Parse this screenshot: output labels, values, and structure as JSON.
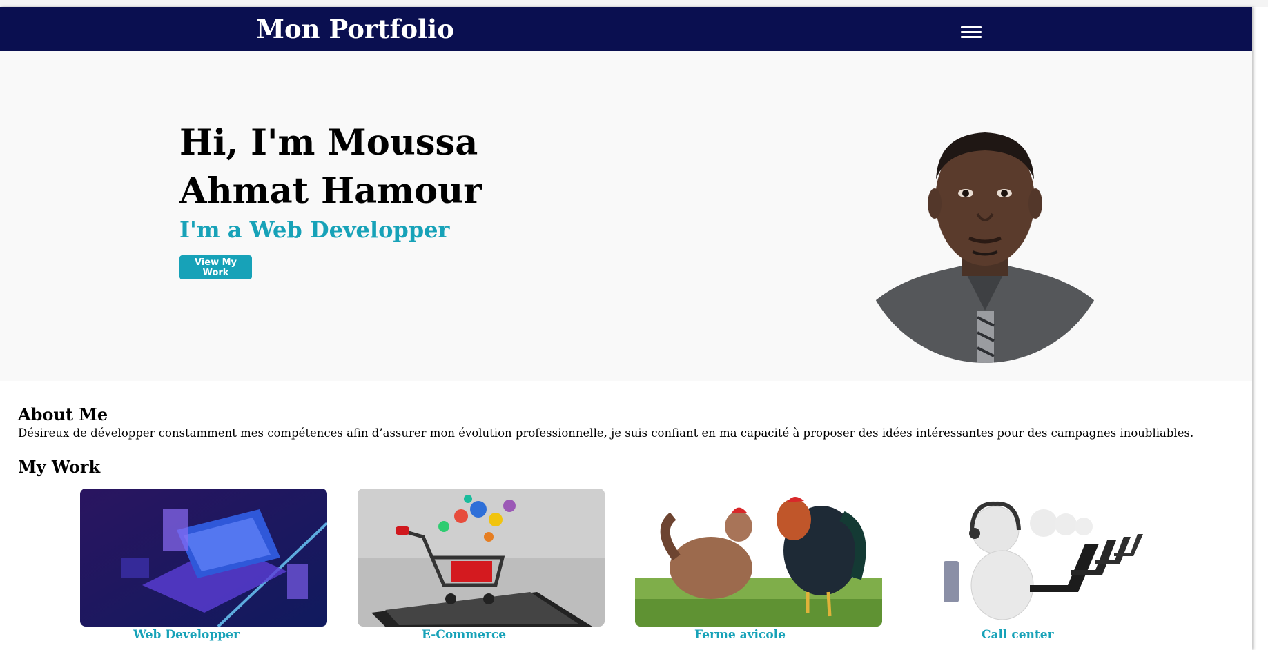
{
  "navbar": {
    "brand": "Mon Portfolio",
    "menu_icon": "hamburger-menu-icon"
  },
  "hero": {
    "title": "Hi, I'm Moussa Ahmat Hamour",
    "subtitle": "I'm a Web Developper",
    "cta_label": "View My Work",
    "accent_color": "#17a2b8",
    "nav_color": "#0a0f50"
  },
  "about": {
    "title": "About Me",
    "text": "Désireux de développer constamment mes compétences afin d’assurer mon évolution professionnelle, je suis confiant en ma capacité à proposer des idées intéressantes pour des campagnes inoubliables."
  },
  "work": {
    "title": "My Work",
    "items": [
      {
        "label": "Web Developper"
      },
      {
        "label": "E-Commerce"
      },
      {
        "label": "Ferme avicole"
      },
      {
        "label": "Call center"
      }
    ]
  }
}
